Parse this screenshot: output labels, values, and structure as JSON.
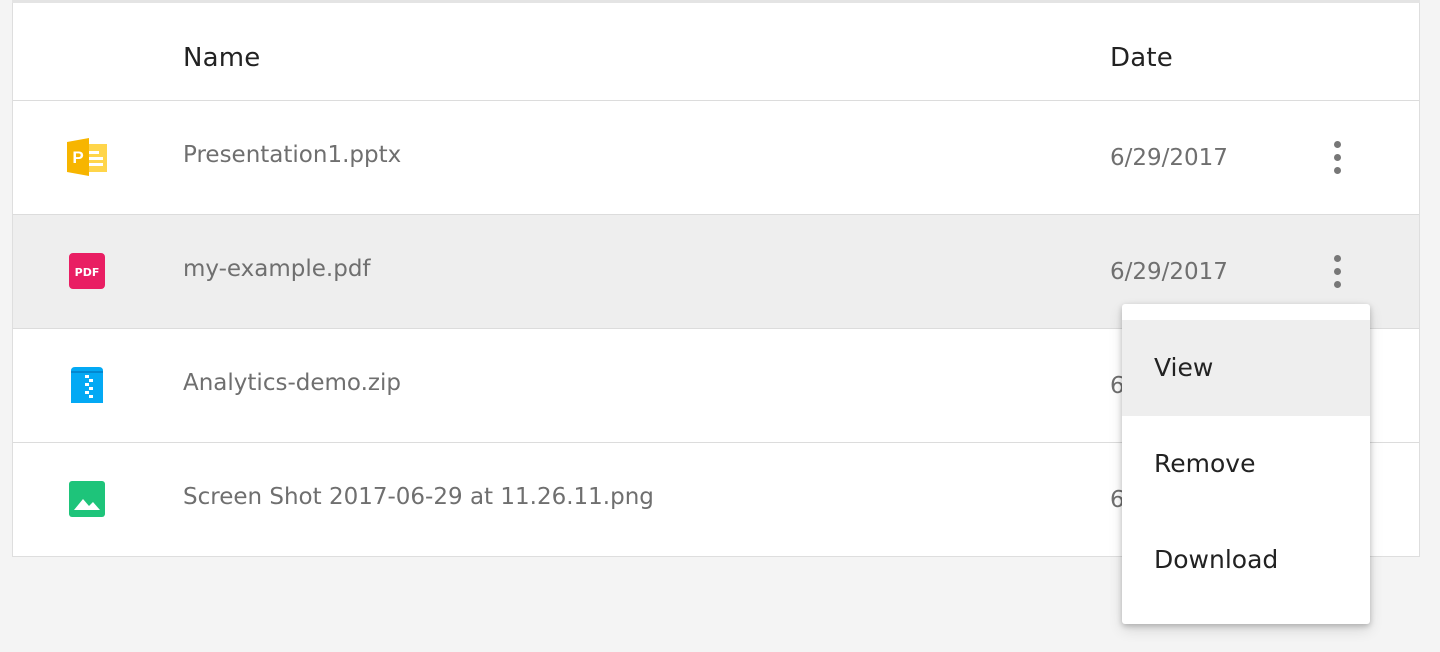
{
  "table": {
    "headers": {
      "name": "Name",
      "date": "Date"
    },
    "rows": [
      {
        "name": "Presentation1.pptx",
        "date": "6/29/2017",
        "icon": "powerpoint-file-icon",
        "icon_color": "#f7b500",
        "selected": false
      },
      {
        "name": "my-example.pdf",
        "date": "6/29/2017",
        "icon": "pdf-file-icon",
        "icon_color": "#e91e63",
        "icon_label": "PDF",
        "selected": true
      },
      {
        "name": "Analytics-demo.zip",
        "date": "6",
        "icon": "zip-file-icon",
        "icon_color": "#03a9f4",
        "selected": false
      },
      {
        "name": "Screen Shot 2017-06-29 at 11.26.11.png",
        "date": "6",
        "icon": "image-file-icon",
        "icon_color": "#1ec47a",
        "selected": false
      }
    ]
  },
  "context_menu": {
    "items": [
      {
        "label": "View",
        "active": true
      },
      {
        "label": "Remove",
        "active": false
      },
      {
        "label": "Download",
        "active": false
      }
    ]
  },
  "powerpoint_icon_letter": "P"
}
